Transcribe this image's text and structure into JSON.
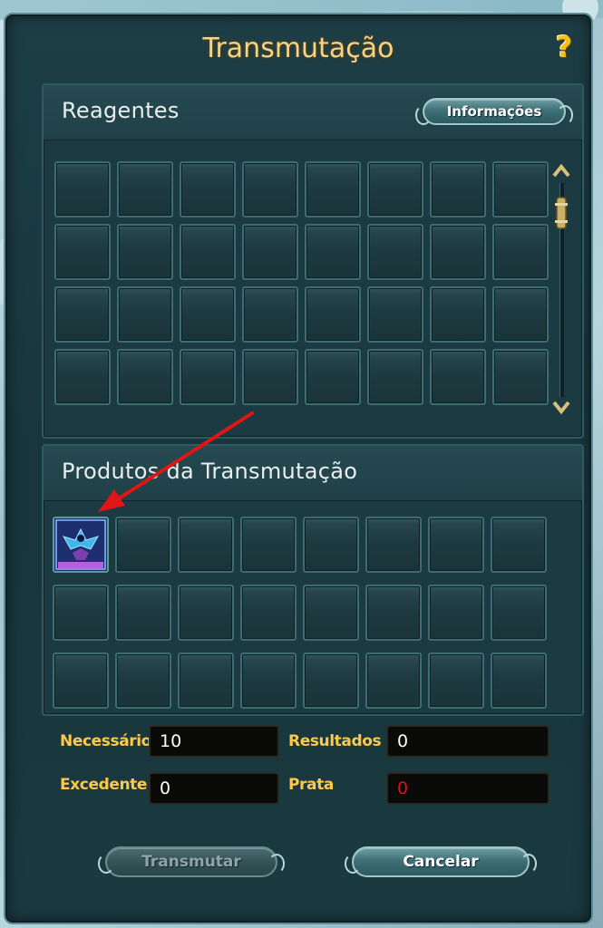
{
  "window": {
    "title": "Transmutação",
    "help_icon": "question-mark-icon"
  },
  "reagents": {
    "title": "Reagentes",
    "info_button_label": "Informações",
    "rows": 4,
    "cols": 8
  },
  "products": {
    "title": "Produtos da Transmutação",
    "rows": 3,
    "cols": 8,
    "filled_slot_icon": "phoenix-item-icon"
  },
  "fields": {
    "necessario": {
      "label": "Necessário",
      "value": "10"
    },
    "resultados": {
      "label": "Resultados",
      "value": "0"
    },
    "excedente": {
      "label": "Excedente",
      "value": "0"
    },
    "prata": {
      "label": "Prata",
      "value": "0"
    }
  },
  "buttons": {
    "transmutar": "Transmutar",
    "cancelar": "Cancelar"
  },
  "colors": {
    "title_gold": "#f2d48a",
    "label_gold": "#ffc84a",
    "prata_value_red": "#e01010",
    "annotation_arrow_red": "#e01515"
  }
}
